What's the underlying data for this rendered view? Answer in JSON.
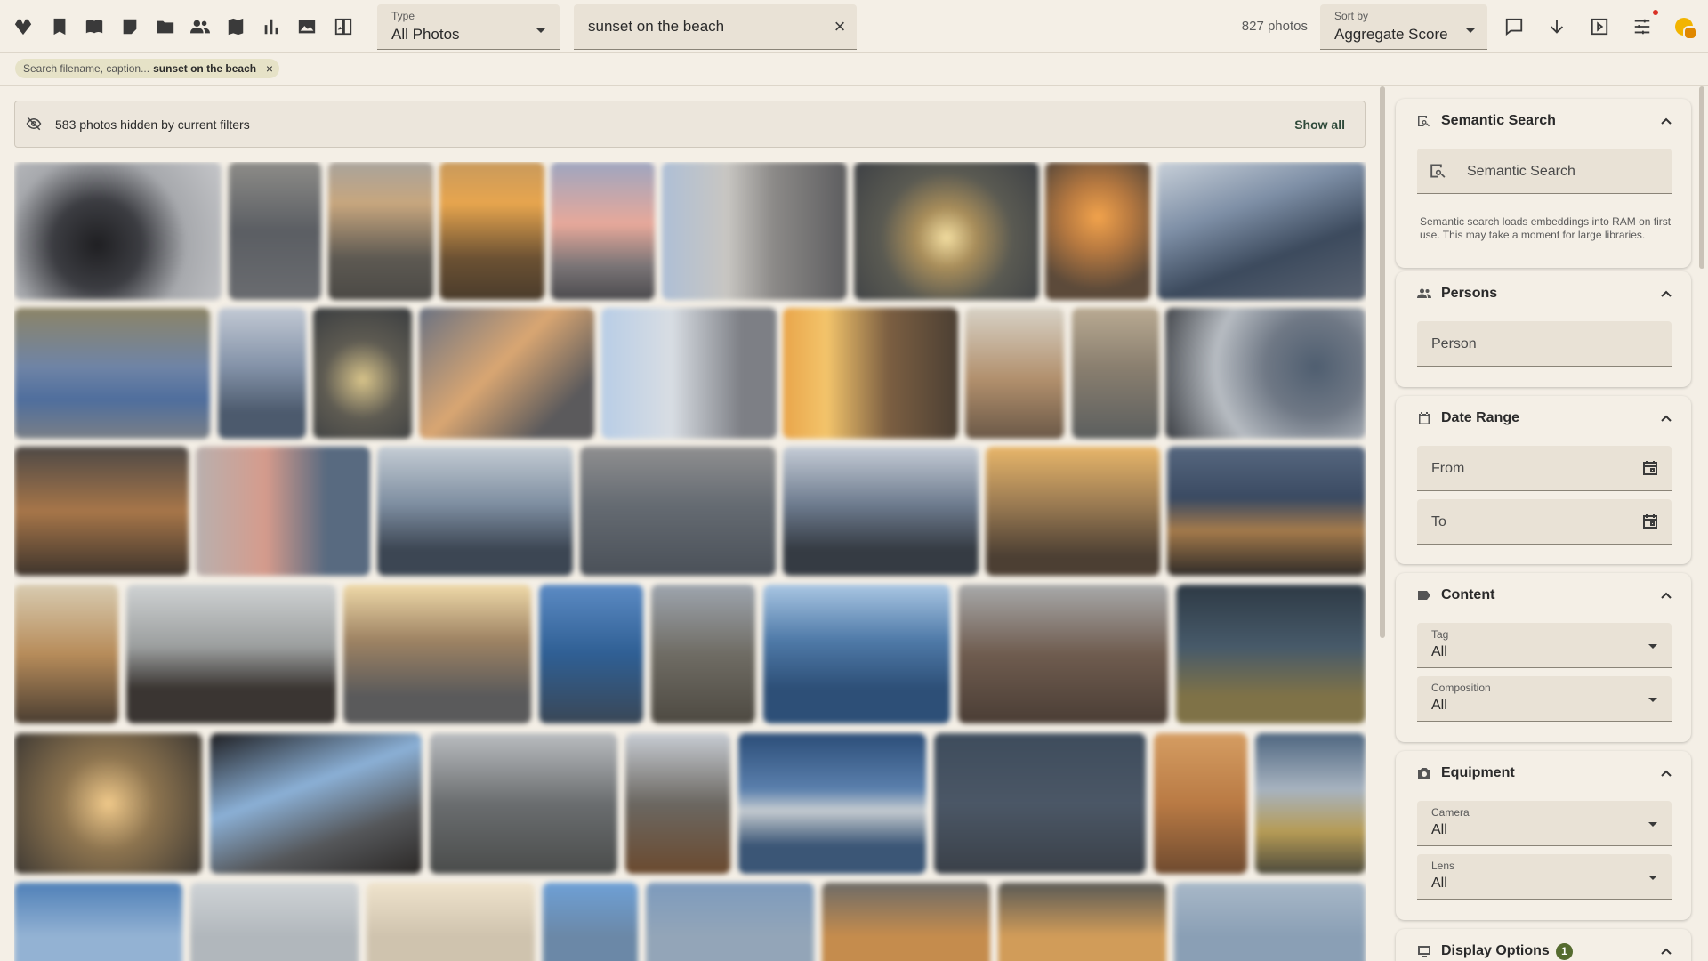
{
  "topbar": {
    "nav_icons": [
      "diamond-icon",
      "bookmark-icon",
      "book-icon",
      "notes-icon",
      "folder-icon",
      "people-icon",
      "map-icon",
      "bar-chart-icon",
      "photo-library-icon",
      "compare-icon"
    ],
    "type_label": "Type",
    "type_value": "All Photos",
    "search_value": "sunset on the beach",
    "photo_count": "827 photos",
    "sort_label": "Sort by",
    "sort_value": "Aggregate Score",
    "tool_icons": [
      "comment-icon",
      "arrow-down-icon",
      "slideshow-icon",
      "tune-icon",
      "coin-icon"
    ]
  },
  "chip": {
    "label": "Search filename, caption...",
    "value": "sunset on the beach",
    "remove": "×"
  },
  "banner": {
    "text": "583 photos hidden by current filters",
    "action": "Show all"
  },
  "sidebar": {
    "semantic": {
      "title": "Semantic Search",
      "placeholder": "Semantic Search",
      "hint": "Semantic search loads embeddings into RAM on first use. This may take a moment for large libraries."
    },
    "persons": {
      "title": "Persons",
      "placeholder": "Person"
    },
    "date_range": {
      "title": "Date Range",
      "from": "From",
      "to": "To"
    },
    "content": {
      "title": "Content",
      "tag_label": "Tag",
      "tag_value": "All",
      "composition_label": "Composition",
      "composition_value": "All"
    },
    "equipment": {
      "title": "Equipment",
      "camera_label": "Camera",
      "camera_value": "All",
      "lens_label": "Lens",
      "lens_value": "All"
    },
    "display": {
      "title": "Display Options",
      "badge": "1"
    }
  },
  "colors": {
    "background": "#f4efe6",
    "field": "#e9e2d6",
    "chip": "#e6e2c7",
    "accent_green": "#556b2f",
    "notification": "#d93025"
  },
  "photo_grid": {
    "rows": [
      {
        "tones": [
          "portrait-dark",
          "grey",
          "sunset-dim",
          "sunset-orange",
          "pink-sky",
          "pale-blue",
          "bright-sun",
          "orange-glow",
          "blue-coast"
        ]
      },
      {
        "tones": [
          "blue-shore",
          "grey-blue",
          "dark-sun",
          "orange-cloud",
          "pale-blue",
          "golden",
          "warm",
          "grey",
          "portrait-blue"
        ]
      },
      {
        "tones": [
          "orange-dusk",
          "pink-portrait",
          "grey-blue",
          "grey",
          "dusk",
          "amber",
          "dark-blue"
        ]
      },
      {
        "tones": [
          "warm-shore",
          "dusk-grey",
          "golden-sky",
          "deep-blue",
          "warm-grey",
          "blue-water",
          "brown-dusk",
          "dark-olive"
        ]
      },
      {
        "tones": [
          "sunset-gold",
          "blue-dark",
          "grey-cloud",
          "grey-brown",
          "deep-blue",
          "slate",
          "orange",
          "blue-olive"
        ]
      },
      {
        "tones": [
          "blue",
          "pale-grey",
          "pale-warm",
          "blue-bright",
          "steel",
          "dusk-orange",
          "golden",
          "pale-blue"
        ]
      }
    ]
  }
}
